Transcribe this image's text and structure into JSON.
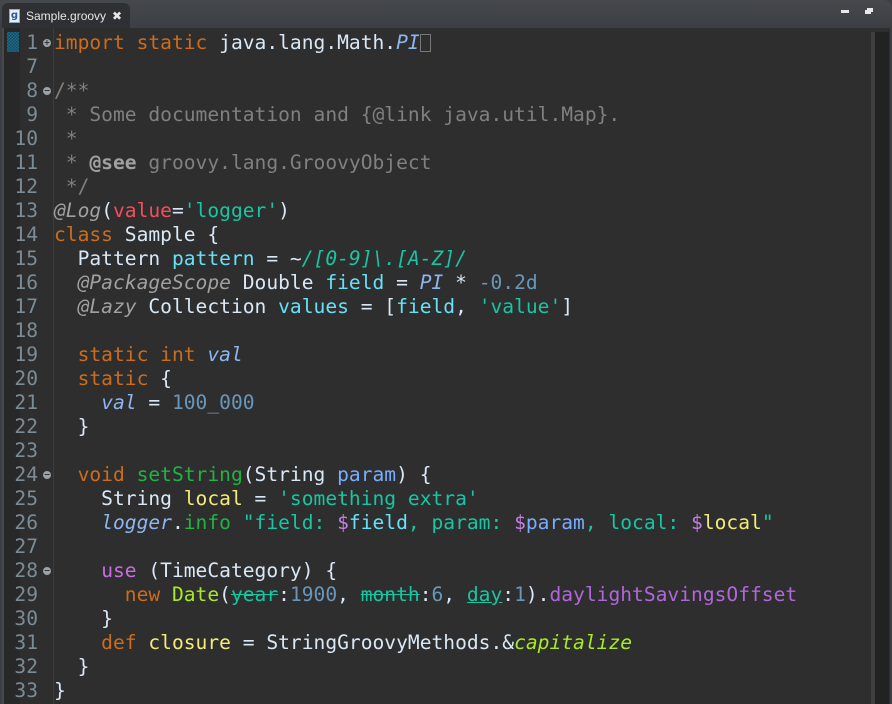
{
  "window": {
    "tab": {
      "label": "Sample.groovy",
      "icon": "groovy-file-icon",
      "close_icon": "close-icon"
    },
    "controls": {
      "minimize": "minimize-icon",
      "maximize": "restore-icon"
    }
  },
  "editor": {
    "language": "groovy",
    "lines": [
      {
        "n": "1",
        "fold": "+",
        "tokens": [
          [
            "kw",
            "import"
          ],
          [
            "",
            " "
          ],
          [
            "kw",
            "static"
          ],
          [
            "",
            " java.lang.Math."
          ],
          [
            "staticf",
            "PI"
          ]
        ],
        "cursor_box": true
      },
      {
        "n": "7",
        "tokens": []
      },
      {
        "n": "8",
        "fold": "-",
        "tokens": [
          [
            "cm",
            "/**"
          ]
        ]
      },
      {
        "n": "9",
        "tokens": [
          [
            "cm",
            " * Some documentation and {@link java.util.Map}."
          ]
        ]
      },
      {
        "n": "10",
        "tokens": [
          [
            "cm",
            " *"
          ]
        ]
      },
      {
        "n": "11",
        "tokens": [
          [
            "cm",
            " * "
          ],
          [
            "cmtag",
            "@see"
          ],
          [
            "cm",
            " groovy.lang.GroovyObject"
          ]
        ]
      },
      {
        "n": "12",
        "tokens": [
          [
            "cm",
            " */"
          ]
        ]
      },
      {
        "n": "13",
        "tokens": [
          [
            "ann",
            "@Log"
          ],
          [
            "",
            "("
          ],
          [
            "pink",
            "value"
          ],
          [
            "",
            "="
          ],
          [
            "str",
            "'logger'"
          ],
          [
            "",
            ")"
          ]
        ]
      },
      {
        "n": "14",
        "tokens": [
          [
            "kw",
            "class"
          ],
          [
            "",
            " Sample {"
          ]
        ]
      },
      {
        "n": "15",
        "tokens": [
          [
            "",
            "  Pattern "
          ],
          [
            "field",
            "pattern"
          ],
          [
            "",
            " = ~"
          ],
          [
            "str ital",
            "/[0-9]\\.[A-Z]/"
          ]
        ]
      },
      {
        "n": "16",
        "tokens": [
          [
            "ann",
            "  @PackageScope"
          ],
          [
            "",
            " Double "
          ],
          [
            "field",
            "field"
          ],
          [
            "",
            " = "
          ],
          [
            "staticf",
            "PI"
          ],
          [
            "",
            " * "
          ],
          [
            "num",
            "-0.2d"
          ]
        ]
      },
      {
        "n": "17",
        "tokens": [
          [
            "ann",
            "  @Lazy"
          ],
          [
            "",
            " Collection "
          ],
          [
            "field",
            "values"
          ],
          [
            "",
            " = ["
          ],
          [
            "field",
            "field"
          ],
          [
            "",
            ", "
          ],
          [
            "str",
            "'value'"
          ],
          [
            "",
            "]"
          ]
        ]
      },
      {
        "n": "18",
        "tokens": []
      },
      {
        "n": "19",
        "tokens": [
          [
            "kw",
            "  static int"
          ],
          [
            "",
            ""
          ],
          [
            "",
            " "
          ],
          [
            "staticf",
            "val"
          ]
        ]
      },
      {
        "n": "20",
        "tokens": [
          [
            "kw",
            "  static"
          ],
          [
            "",
            " {"
          ]
        ]
      },
      {
        "n": "21",
        "tokens": [
          [
            "",
            "    "
          ],
          [
            "staticf",
            "val"
          ],
          [
            "",
            " = "
          ],
          [
            "num",
            "100_000"
          ]
        ]
      },
      {
        "n": "22",
        "tokens": [
          [
            "",
            "  }"
          ]
        ]
      },
      {
        "n": "23",
        "tokens": []
      },
      {
        "n": "24",
        "fold": "-",
        "tokens": [
          [
            "kw",
            "  void"
          ],
          [
            "",
            " "
          ],
          [
            "method",
            "setString"
          ],
          [
            "",
            "(String "
          ],
          [
            "param",
            "param"
          ],
          [
            "",
            ") {"
          ]
        ]
      },
      {
        "n": "25",
        "tokens": [
          [
            "",
            "    String "
          ],
          [
            "local",
            "local"
          ],
          [
            "",
            " = "
          ],
          [
            "str",
            "'something extra'"
          ]
        ]
      },
      {
        "n": "26",
        "tokens": [
          [
            "",
            "    "
          ],
          [
            "staticf",
            "logger"
          ],
          [
            "",
            "."
          ],
          [
            "method",
            "info"
          ],
          [
            "",
            " "
          ],
          [
            "str",
            "\"field: "
          ],
          [
            "dollar",
            "$"
          ],
          [
            "field",
            "field"
          ],
          [
            "str",
            ", param: "
          ],
          [
            "dollar",
            "$"
          ],
          [
            "param",
            "param"
          ],
          [
            "str",
            ", local: "
          ],
          [
            "dollar",
            "$"
          ],
          [
            "local",
            "local"
          ],
          [
            "str",
            "\""
          ]
        ]
      },
      {
        "n": "27",
        "tokens": []
      },
      {
        "n": "28",
        "fold": "-",
        "tokens": [
          [
            "",
            "    "
          ],
          [
            "use-kw",
            "use"
          ],
          [
            "",
            " (TimeCategory) {"
          ]
        ]
      },
      {
        "n": "29",
        "tokens": [
          [
            "",
            "      "
          ],
          [
            "kw",
            "new"
          ],
          [
            "",
            " "
          ],
          [
            "ctor",
            "Date"
          ],
          [
            "",
            "("
          ],
          [
            "strike",
            "year"
          ],
          [
            "",
            ":"
          ],
          [
            "num",
            "1900"
          ],
          [
            "",
            ", "
          ],
          [
            "strike",
            "month"
          ],
          [
            "",
            ":"
          ],
          [
            "num",
            "6"
          ],
          [
            "",
            ", "
          ],
          [
            "under",
            "day"
          ],
          [
            "",
            ":"
          ],
          [
            "num",
            "1"
          ],
          [
            "",
            ")."
          ],
          [
            "prop",
            "daylightSavingsOffset"
          ]
        ]
      },
      {
        "n": "30",
        "tokens": [
          [
            "",
            "    }"
          ]
        ]
      },
      {
        "n": "31",
        "tokens": [
          [
            "kw",
            "    def"
          ],
          [
            "",
            " "
          ],
          [
            "local",
            "closure"
          ],
          [
            "",
            " = StringGroovyMethods.&"
          ],
          [
            "mref",
            "capitalize"
          ]
        ]
      },
      {
        "n": "32",
        "tokens": [
          [
            "",
            "  }"
          ]
        ]
      },
      {
        "n": "33",
        "tokens": [
          [
            "",
            "}"
          ]
        ]
      }
    ]
  }
}
